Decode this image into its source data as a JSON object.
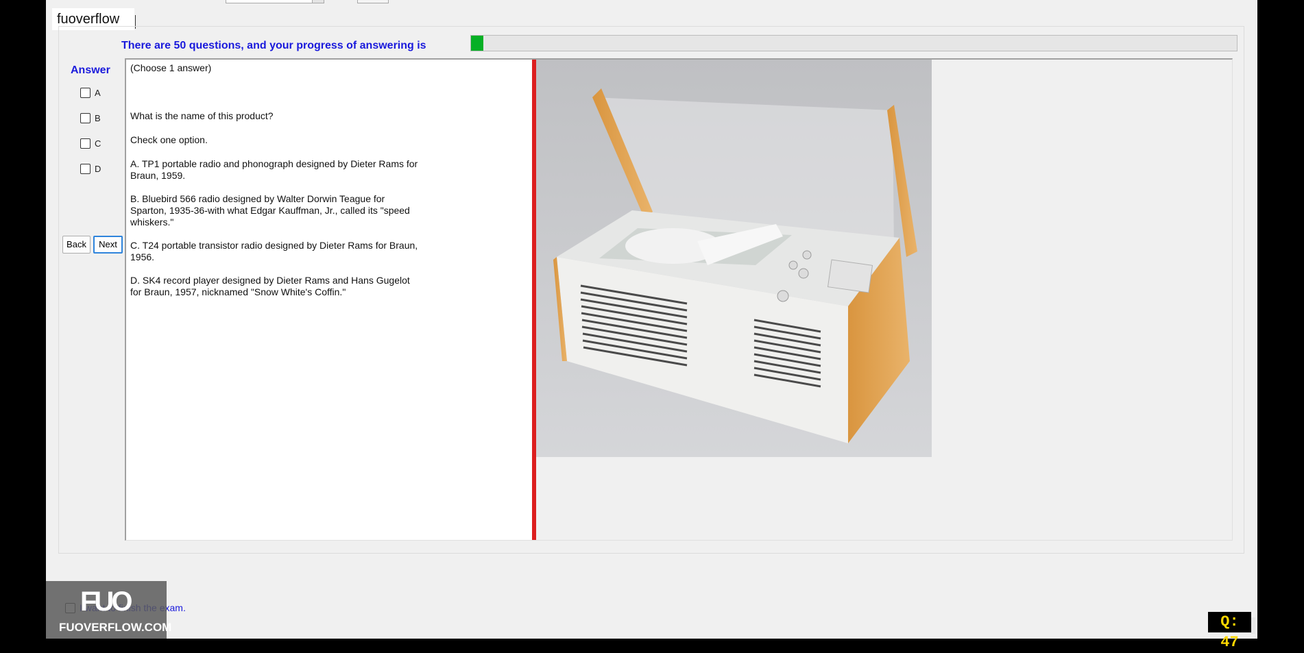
{
  "brand": "fuoverflow",
  "timer": "",
  "progress": {
    "text": "There are 50 questions, and your progress of answering is",
    "fraction": 0.016,
    "color": "#06b025"
  },
  "answer": {
    "title": "Answer",
    "options": [
      "A",
      "B",
      "C",
      "D"
    ]
  },
  "nav": {
    "back": "Back",
    "next": "Next"
  },
  "question": {
    "instruction": "(Choose 1 answer)",
    "prompt": "What is the name of this product?",
    "hint": "Check one option.",
    "choices": [
      "A.  TP1 portable radio and phonograph designed by Dieter Rams for Braun, 1959.",
      "B.  Bluebird 566 radio designed by Walter Dorwin Teague for Sparton, 1935-36-with what Edgar Kauffman, Jr., called its \"speed whiskers.\"",
      "C.  T24 portable transistor radio designed by Dieter Rams for Braun, 1956.",
      "D.  SK4 record player designed by Dieter Rams and Hans Gugelot for Braun, 1957, nicknamed \"Snow White's Coffin.\""
    ]
  },
  "divider_color": "#dc1e1e",
  "finish": {
    "label": "I want to finish the exam."
  },
  "watermark": {
    "mark": "FUO",
    "site": "FUOVERFLOW.COM"
  },
  "counter": "Q: 47"
}
